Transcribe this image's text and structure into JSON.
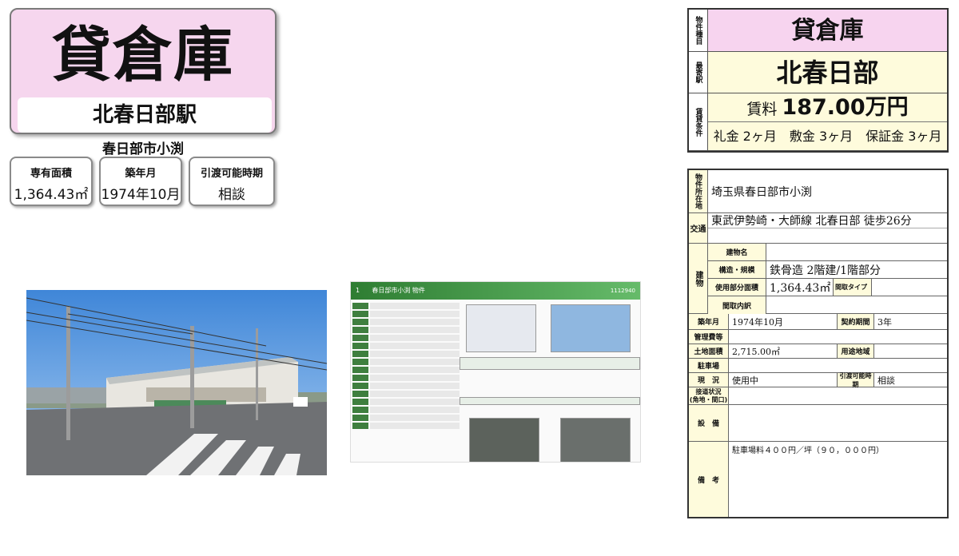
{
  "title": {
    "property_type": "貸倉庫",
    "station": "北春日部駅"
  },
  "address_short": "春日部市小渕",
  "info_boxes": [
    {
      "label": "専有面積",
      "value": "1,364.43㎡"
    },
    {
      "label": "築年月",
      "value": "1974年10月"
    },
    {
      "label": "引渡可能時期",
      "value": "相談"
    }
  ],
  "doc_thumb": {
    "header_num": "1",
    "header_title": "春日部市小渕 物件",
    "header_id": "1112940"
  },
  "sheet_top": {
    "type_label": "物件種目",
    "type_value": "貸倉庫",
    "station_label": "最寄駅",
    "station_value": "北春日部",
    "terms_label": "賃貸条件",
    "rent_prefix": "賃料",
    "rent_value": "187.00万円",
    "fees": "礼金 2ヶ月　敷金 3ヶ月　保証金 3ヶ月"
  },
  "sheet": {
    "location_label": "物件所在地",
    "location_value": "埼玉県春日部市小渕",
    "transport_label": "交通",
    "transport_value": "東武伊勢崎・大師線 北春日部 徒歩26分",
    "building_label": "建物",
    "building_name_label": "建物名",
    "building_name_value": "",
    "structure_label": "構造・規模",
    "structure_value": "鉄骨造 2階建/1階部分",
    "area_label": "使用部分面積",
    "area_value": "1,364.43㎡",
    "layout_type_label": "間取タイプ",
    "layout_detail_label": "間取内訳",
    "built_label": "築年月",
    "built_value": "1974年10月",
    "contract_label": "契約期間",
    "contract_value": "3年",
    "mgmt_label": "管理費等",
    "land_label": "土地面積",
    "land_value": "2,715.00㎡",
    "zoning_label": "用途地域",
    "parking_label": "駐車場",
    "status_label": "現　況",
    "status_value": "使用中",
    "handover_label": "引渡可能時期",
    "handover_value": "相談",
    "road_label": "接道状況",
    "road_sub": "(角地・間口)",
    "equipment_label": "設　備",
    "remarks_label": "備　考",
    "remarks_value": "駐車場料４００円／坪（９０，０００円）"
  }
}
